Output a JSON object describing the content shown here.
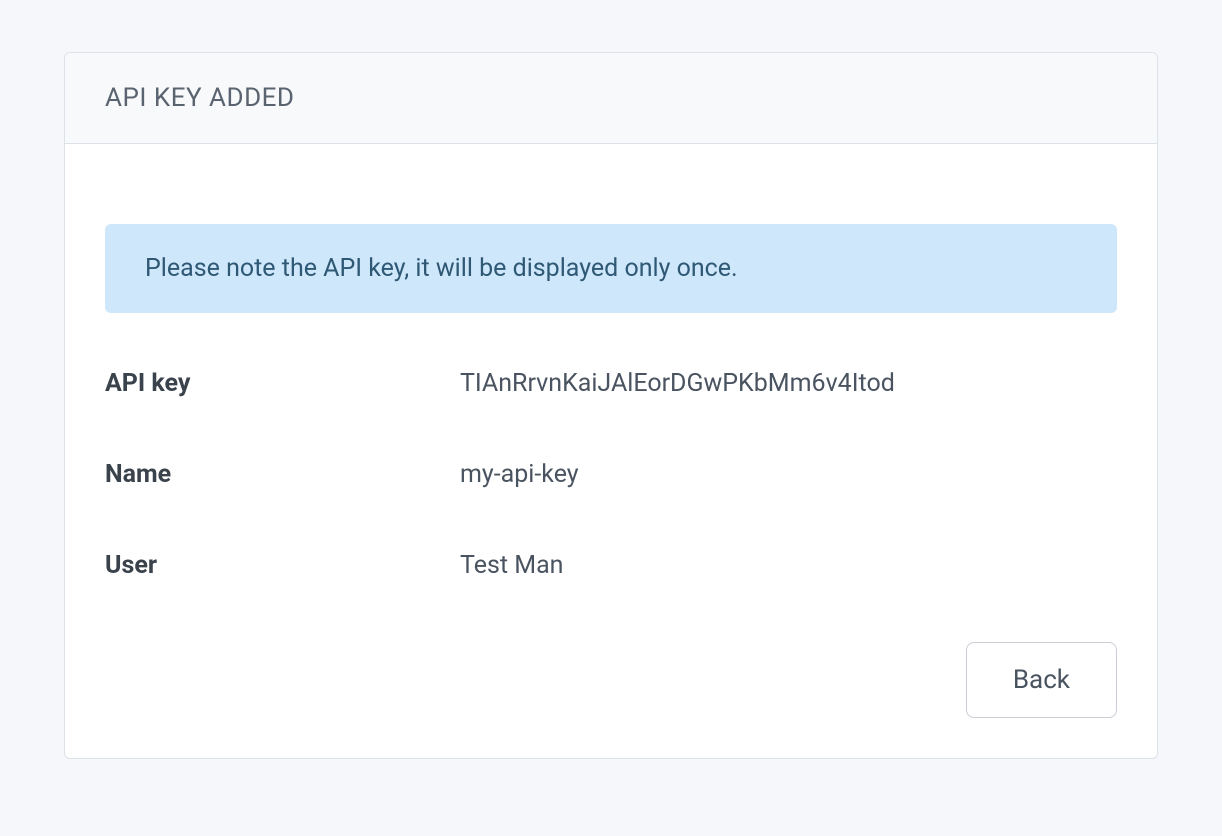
{
  "card": {
    "header_title": "API KEY ADDED",
    "alert_text": "Please note the API key, it will be displayed only once.",
    "fields": {
      "api_key": {
        "label": "API key",
        "value": "TIAnRrvnKaiJAlEorDGwPKbMm6v4Itod"
      },
      "name": {
        "label": "Name",
        "value": "my-api-key"
      },
      "user": {
        "label": "User",
        "value": "Test Man"
      }
    },
    "back_button_label": "Back"
  }
}
